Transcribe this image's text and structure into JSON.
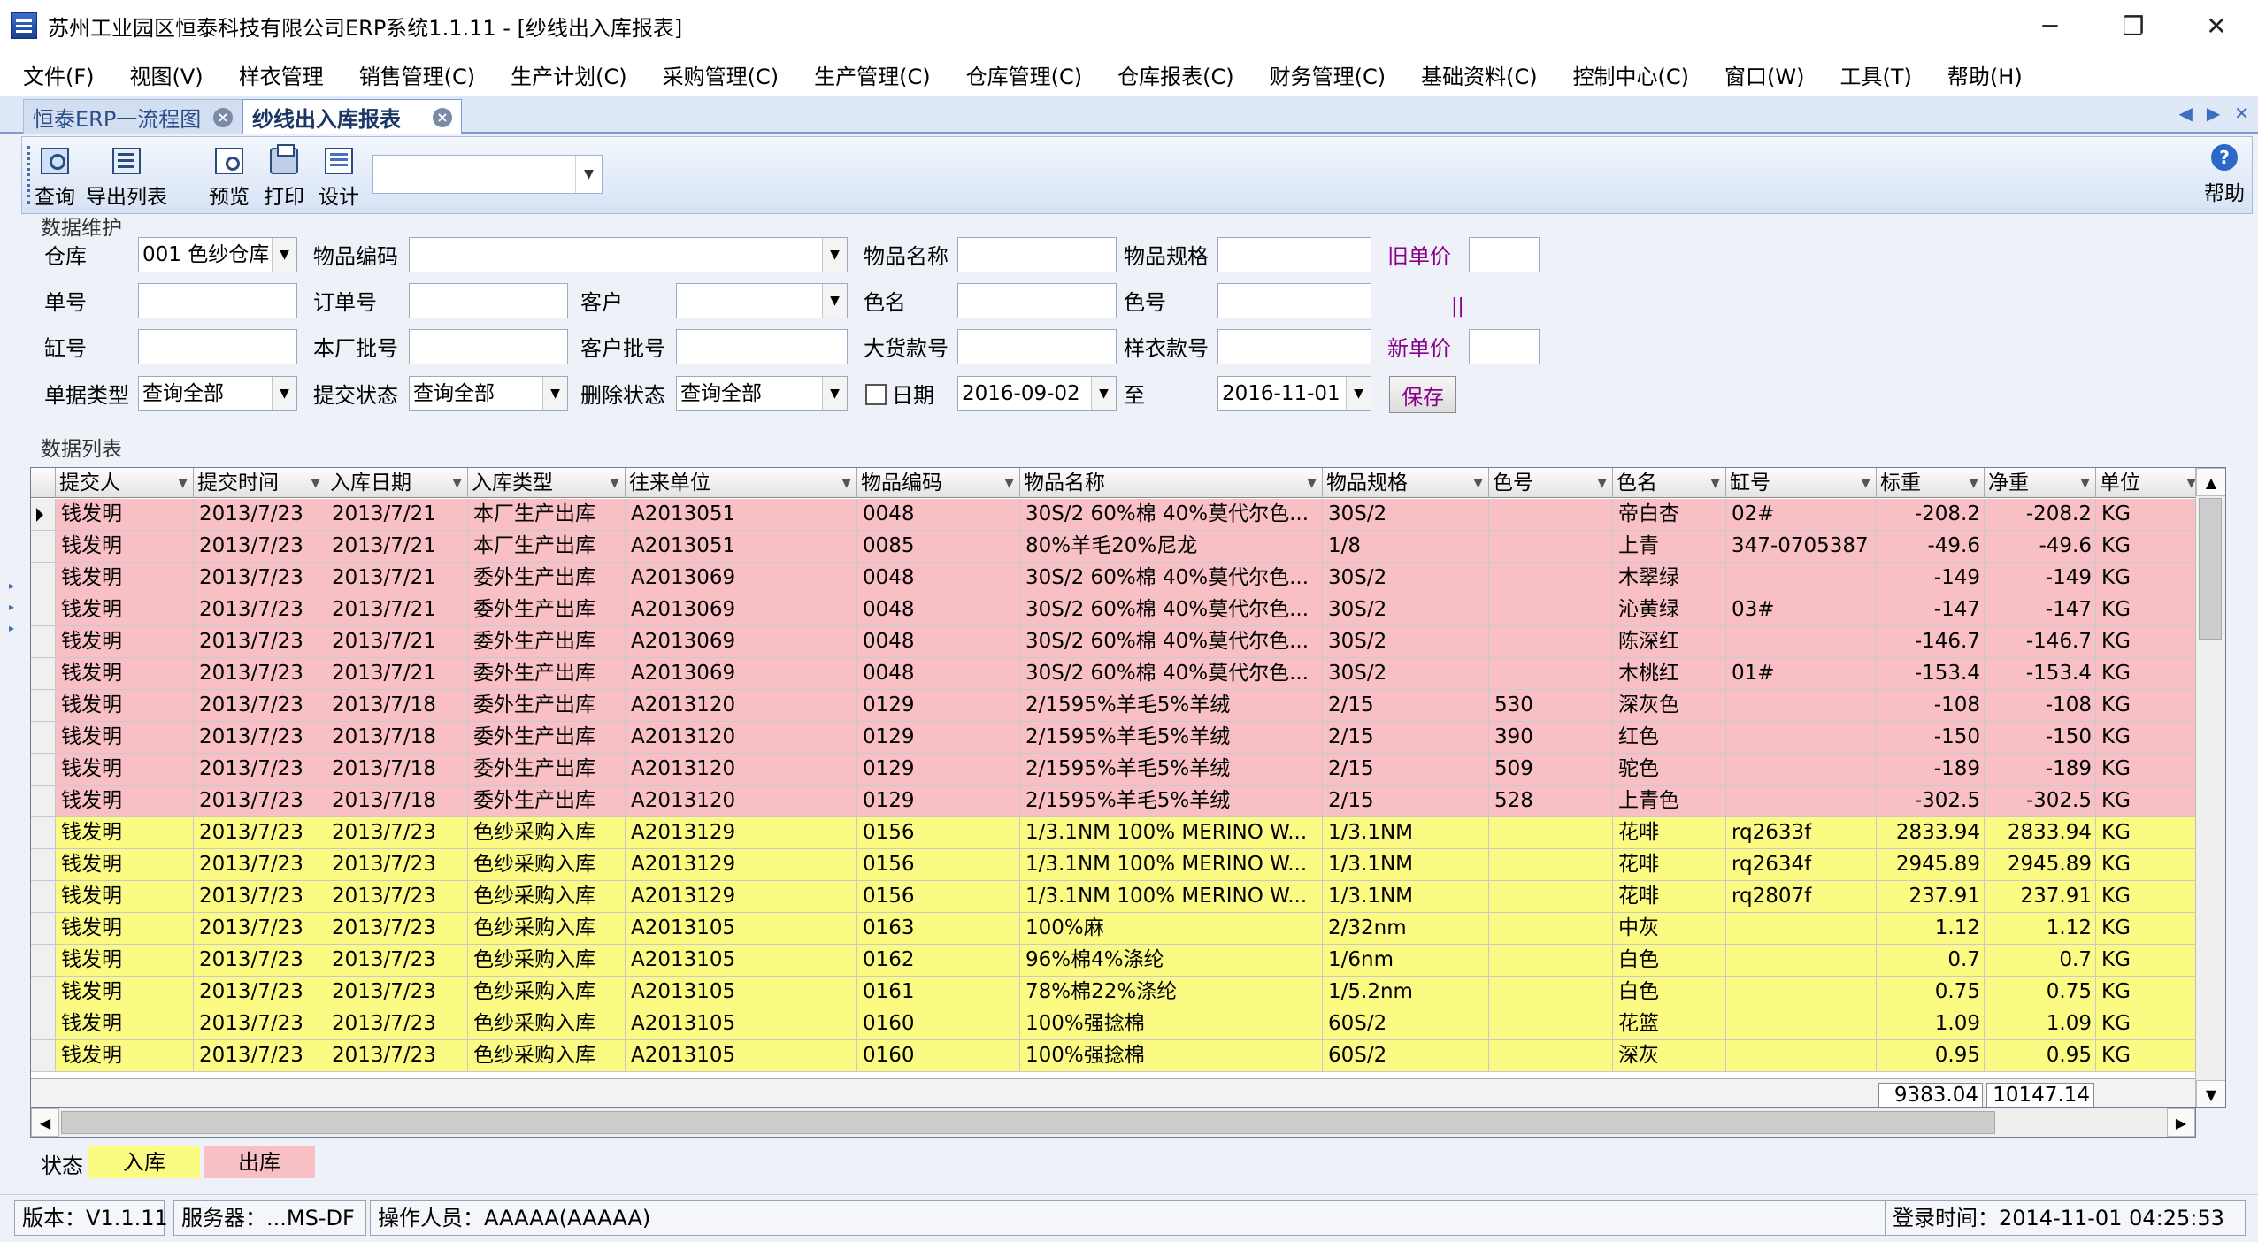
{
  "window": {
    "title": "苏州工业园区恒泰科技有限公司ERP系统1.1.11 - [纱线出入库报表]",
    "controls": [
      "─",
      "❐",
      "✕"
    ]
  },
  "menu": [
    "文件(F)",
    "视图(V)",
    "样衣管理",
    "销售管理(C)",
    "生产计划(C)",
    "采购管理(C)",
    "生产管理(C)",
    "仓库管理(C)",
    "仓库报表(C)",
    "财务管理(C)",
    "基础资料(C)",
    "控制中心(C)",
    "窗口(W)",
    "工具(T)",
    "帮助(H)"
  ],
  "tabs": [
    {
      "label": "恒泰ERP一流程图",
      "active": false
    },
    {
      "label": "纱线出入库报表",
      "active": true
    }
  ],
  "tab_nav": [
    "◀",
    "▶",
    "✕"
  ],
  "toolbar": {
    "buttons": [
      {
        "label": "查询",
        "icon": "query-icon"
      },
      {
        "label": "导出列表",
        "icon": "export-icon"
      },
      {
        "label": "预览",
        "icon": "preview-icon"
      },
      {
        "label": "打印",
        "icon": "print-icon"
      },
      {
        "label": "设计",
        "icon": "design-icon"
      }
    ],
    "combo_value": "",
    "help_label": "帮助",
    "help_glyph": "?"
  },
  "form": {
    "section_title": "数据维护",
    "labels": {
      "warehouse": "仓库",
      "item_code": "物品编码",
      "item_name": "物品名称",
      "item_spec": "物品规格",
      "old_price": "旧单价",
      "doc_no": "单号",
      "order_no": "订单号",
      "customer": "客户",
      "color_name": "色名",
      "color_no": "色号",
      "vat_no": "缸号",
      "factory_batch": "本厂批号",
      "customer_batch": "客户批号",
      "bulk_style": "大货款号",
      "sample_style": "样衣款号",
      "new_price": "新单价",
      "doc_type": "单据类型",
      "submit_status": "提交状态",
      "delete_status": "删除状态",
      "date": "日期",
      "to": "至"
    },
    "values": {
      "warehouse": "001 色纱仓库",
      "doc_type": "查询全部",
      "submit_status": "查询全部",
      "delete_status": "查询全部",
      "date_from": "2016-09-02",
      "date_to": "2016-11-01"
    },
    "marker": "||",
    "save_label": "保存"
  },
  "grid": {
    "section_title": "数据列表",
    "columns": [
      "提交人",
      "提交时间",
      "入库日期",
      "入库类型",
      "往来单位",
      "物品编码",
      "物品名称",
      "物品规格",
      "色号",
      "色名",
      "缸号",
      "标重",
      "净重",
      "单位"
    ],
    "rows": [
      {
        "status": "out",
        "cells": [
          "钱发明",
          "2013/7/23",
          "2013/7/21",
          "本厂生产出库",
          "A2013051",
          "0048",
          "30S/2 60%棉 40%莫代尔色...",
          "30S/2",
          "",
          "帝白杏",
          "02#",
          "-208.2",
          "-208.2",
          "KG"
        ]
      },
      {
        "status": "out",
        "cells": [
          "钱发明",
          "2013/7/23",
          "2013/7/21",
          "本厂生产出库",
          "A2013051",
          "0085",
          "80%羊毛20%尼龙",
          "1/8",
          "",
          "上青",
          "347-0705387",
          "-49.6",
          "-49.6",
          "KG"
        ]
      },
      {
        "status": "out",
        "cells": [
          "钱发明",
          "2013/7/23",
          "2013/7/21",
          "委外生产出库",
          "A2013069",
          "0048",
          "30S/2 60%棉 40%莫代尔色...",
          "30S/2",
          "",
          "木翠绿",
          "",
          "-149",
          "-149",
          "KG"
        ]
      },
      {
        "status": "out",
        "cells": [
          "钱发明",
          "2013/7/23",
          "2013/7/21",
          "委外生产出库",
          "A2013069",
          "0048",
          "30S/2 60%棉 40%莫代尔色...",
          "30S/2",
          "",
          "沁黄绿",
          "03#",
          "-147",
          "-147",
          "KG"
        ]
      },
      {
        "status": "out",
        "cells": [
          "钱发明",
          "2013/7/23",
          "2013/7/21",
          "委外生产出库",
          "A2013069",
          "0048",
          "30S/2 60%棉 40%莫代尔色...",
          "30S/2",
          "",
          "陈深红",
          "",
          "-146.7",
          "-146.7",
          "KG"
        ]
      },
      {
        "status": "out",
        "cells": [
          "钱发明",
          "2013/7/23",
          "2013/7/21",
          "委外生产出库",
          "A2013069",
          "0048",
          "30S/2 60%棉 40%莫代尔色...",
          "30S/2",
          "",
          "木桃红",
          "01#",
          "-153.4",
          "-153.4",
          "KG"
        ]
      },
      {
        "status": "out",
        "cells": [
          "钱发明",
          "2013/7/23",
          "2013/7/18",
          "委外生产出库",
          "A2013120",
          "0129",
          "2/1595%羊毛5%羊绒",
          "2/15",
          "530",
          "深灰色",
          "",
          "-108",
          "-108",
          "KG"
        ]
      },
      {
        "status": "out",
        "cells": [
          "钱发明",
          "2013/7/23",
          "2013/7/18",
          "委外生产出库",
          "A2013120",
          "0129",
          "2/1595%羊毛5%羊绒",
          "2/15",
          "390",
          "红色",
          "",
          "-150",
          "-150",
          "KG"
        ]
      },
      {
        "status": "out",
        "cells": [
          "钱发明",
          "2013/7/23",
          "2013/7/18",
          "委外生产出库",
          "A2013120",
          "0129",
          "2/1595%羊毛5%羊绒",
          "2/15",
          "509",
          "驼色",
          "",
          "-189",
          "-189",
          "KG"
        ]
      },
      {
        "status": "out",
        "cells": [
          "钱发明",
          "2013/7/23",
          "2013/7/18",
          "委外生产出库",
          "A2013120",
          "0129",
          "2/1595%羊毛5%羊绒",
          "2/15",
          "528",
          "上青色",
          "",
          "-302.5",
          "-302.5",
          "KG"
        ]
      },
      {
        "status": "in",
        "cells": [
          "钱发明",
          "2013/7/23",
          "2013/7/23",
          "色纱采购入库",
          "A2013129",
          "0156",
          "1/3.1NM 100% MERINO W...",
          "1/3.1NM",
          "",
          "花啡",
          "rq2633f",
          "2833.94",
          "2833.94",
          "KG"
        ]
      },
      {
        "status": "in",
        "cells": [
          "钱发明",
          "2013/7/23",
          "2013/7/23",
          "色纱采购入库",
          "A2013129",
          "0156",
          "1/3.1NM 100% MERINO W...",
          "1/3.1NM",
          "",
          "花啡",
          "rq2634f",
          "2945.89",
          "2945.89",
          "KG"
        ]
      },
      {
        "status": "in",
        "cells": [
          "钱发明",
          "2013/7/23",
          "2013/7/23",
          "色纱采购入库",
          "A2013129",
          "0156",
          "1/3.1NM 100% MERINO W...",
          "1/3.1NM",
          "",
          "花啡",
          "rq2807f",
          "237.91",
          "237.91",
          "KG"
        ]
      },
      {
        "status": "in",
        "cells": [
          "钱发明",
          "2013/7/23",
          "2013/7/23",
          "色纱采购入库",
          "A2013105",
          "0163",
          "100%麻",
          "2/32nm",
          "",
          "中灰",
          "",
          "1.12",
          "1.12",
          "KG"
        ]
      },
      {
        "status": "in",
        "cells": [
          "钱发明",
          "2013/7/23",
          "2013/7/23",
          "色纱采购入库",
          "A2013105",
          "0162",
          "96%棉4%涤纶",
          "1/6nm",
          "",
          "白色",
          "",
          "0.7",
          "0.7",
          "KG"
        ]
      },
      {
        "status": "in",
        "cells": [
          "钱发明",
          "2013/7/23",
          "2013/7/23",
          "色纱采购入库",
          "A2013105",
          "0161",
          "78%棉22%涤纶",
          "1/5.2nm",
          "",
          "白色",
          "",
          "0.75",
          "0.75",
          "KG"
        ]
      },
      {
        "status": "in",
        "cells": [
          "钱发明",
          "2013/7/23",
          "2013/7/23",
          "色纱采购入库",
          "A2013105",
          "0160",
          "100%强捻棉",
          "60S/2",
          "",
          "花篮",
          "",
          "1.09",
          "1.09",
          "KG"
        ]
      },
      {
        "status": "in",
        "cells": [
          "钱发明",
          "2013/7/23",
          "2013/7/23",
          "色纱采购入库",
          "A2013105",
          "0160",
          "100%强捻棉",
          "60S/2",
          "",
          "深灰",
          "",
          "0.95",
          "0.95",
          "KG"
        ]
      }
    ],
    "totals": {
      "gross": "9383.04",
      "net": "10147.14"
    }
  },
  "legend": {
    "label": "状态",
    "in": "入库",
    "out": "出库"
  },
  "colors": {
    "in_row": "#fbfb84",
    "out_row": "#f8c0c4",
    "accent": "#8b008b"
  },
  "status": {
    "version": "版本：V1.1.11",
    "server": "服务器：...MS-DF",
    "operator": "操作人员：AAAAA(AAAAA)",
    "login_time": "登录时间：2014-11-01 04:25:53"
  }
}
